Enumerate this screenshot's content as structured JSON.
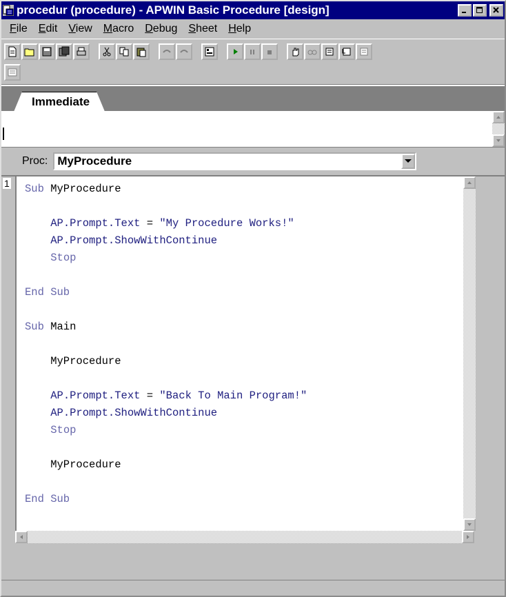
{
  "window": {
    "title": "procedur (procedure) - APWIN Basic Procedure [design]"
  },
  "menu": {
    "items": [
      "File",
      "Edit",
      "View",
      "Macro",
      "Debug",
      "Sheet",
      "Help"
    ],
    "accel": [
      "F",
      "E",
      "V",
      "M",
      "D",
      "S",
      "H"
    ]
  },
  "toolbar": {
    "icons": [
      "new-doc-icon",
      "open-folder-icon",
      "save-icon",
      "save-all-icon",
      "print-icon",
      "cut-icon",
      "copy-icon",
      "paste-icon",
      "undo-icon",
      "redo-icon",
      "dialog-icon",
      "run-icon",
      "pause-icon",
      "stop-icon",
      "hand-icon",
      "watch-icon",
      "step-into-icon",
      "step-over-icon",
      "step-out-icon",
      "list-icon"
    ]
  },
  "immediate": {
    "tab_label": "Immediate",
    "text": ""
  },
  "proc": {
    "label": "Proc:",
    "selected": "MyProcedure"
  },
  "editor": {
    "line_number": "1",
    "lines": [
      [
        [
          "kw",
          "Sub"
        ],
        [
          "plain",
          " MyProcedure"
        ]
      ],
      [],
      [
        [
          "plain",
          "    "
        ],
        [
          "obj",
          "AP.Prompt.Text"
        ],
        [
          "plain",
          " = "
        ],
        [
          "obj",
          "\"My Procedure Works!\""
        ]
      ],
      [
        [
          "plain",
          "    "
        ],
        [
          "obj",
          "AP.Prompt.ShowWithContinue"
        ]
      ],
      [
        [
          "plain",
          "    "
        ],
        [
          "kw",
          "Stop"
        ]
      ],
      [],
      [
        [
          "kw",
          "End Sub"
        ]
      ],
      [],
      [
        [
          "kw",
          "Sub"
        ],
        [
          "plain",
          " Main"
        ]
      ],
      [],
      [
        [
          "plain",
          "    MyProcedure"
        ]
      ],
      [],
      [
        [
          "plain",
          "    "
        ],
        [
          "obj",
          "AP.Prompt.Text"
        ],
        [
          "plain",
          " = "
        ],
        [
          "obj",
          "\"Back To Main Program!\""
        ]
      ],
      [
        [
          "plain",
          "    "
        ],
        [
          "obj",
          "AP.Prompt.ShowWithContinue"
        ]
      ],
      [
        [
          "plain",
          "    "
        ],
        [
          "kw",
          "Stop"
        ]
      ],
      [],
      [
        [
          "plain",
          "    MyProcedure"
        ]
      ],
      [],
      [
        [
          "kw",
          "End Sub"
        ]
      ]
    ]
  },
  "colors": {
    "titlebar": "#000080",
    "keyword": "#6666aa",
    "object": "#202080"
  }
}
